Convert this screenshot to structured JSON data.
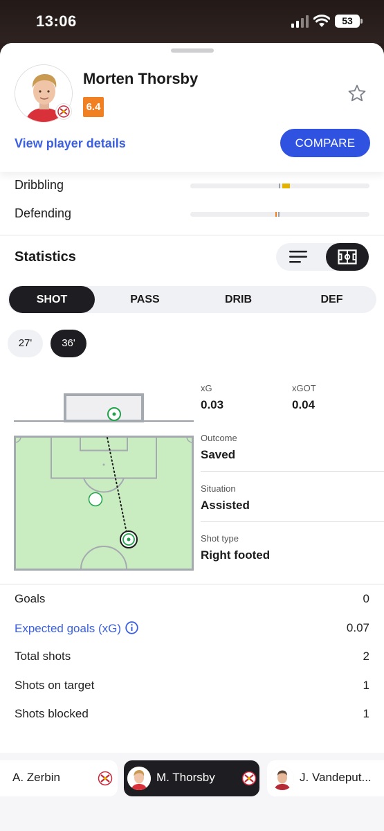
{
  "status_bar": {
    "time": "13:06",
    "battery": "53",
    "icons": [
      "signal-icon",
      "wifi-icon",
      "battery-icon"
    ]
  },
  "player": {
    "name": "Morten Thorsby",
    "rating": "6.4",
    "view_details": "View player details",
    "compare": "COMPARE",
    "rating_color": "#f08022"
  },
  "attributes": [
    {
      "label": "Dribbling",
      "player_color": "#e3b200",
      "compare_color": "#9aa0a8"
    },
    {
      "label": "Defending",
      "player_color": "#f08022",
      "compare_color": "#9aa0a8"
    }
  ],
  "statistics": {
    "title": "Statistics",
    "tabs": [
      "SHOT",
      "PASS",
      "DRIB",
      "DEF"
    ],
    "active_tab": "SHOT",
    "minutes": [
      "27'",
      "36'"
    ],
    "active_minute": "36'"
  },
  "shot": {
    "xg_label": "xG",
    "xg_value": "0.03",
    "xgot_label": "xGOT",
    "xgot_value": "0.04",
    "outcome_label": "Outcome",
    "outcome_value": "Saved",
    "situation_label": "Situation",
    "situation_value": "Assisted",
    "shot_type_label": "Shot type",
    "shot_type_value": "Right footed",
    "pitch_color": "#c9ecc1",
    "marker_color": "#1fa34a"
  },
  "summary": [
    {
      "label": "Goals",
      "value": "0"
    },
    {
      "label": "Expected goals (xG)",
      "value": "0.07"
    },
    {
      "label": "Total shots",
      "value": "2"
    },
    {
      "label": "Shots on target",
      "value": "1"
    },
    {
      "label": "Shots blocked",
      "value": "1"
    }
  ],
  "carousel": [
    {
      "name": "A. Zerbin"
    },
    {
      "name": "M. Thorsby"
    },
    {
      "name": "J. Vandeput..."
    }
  ],
  "accent_color": "#2f52e0"
}
